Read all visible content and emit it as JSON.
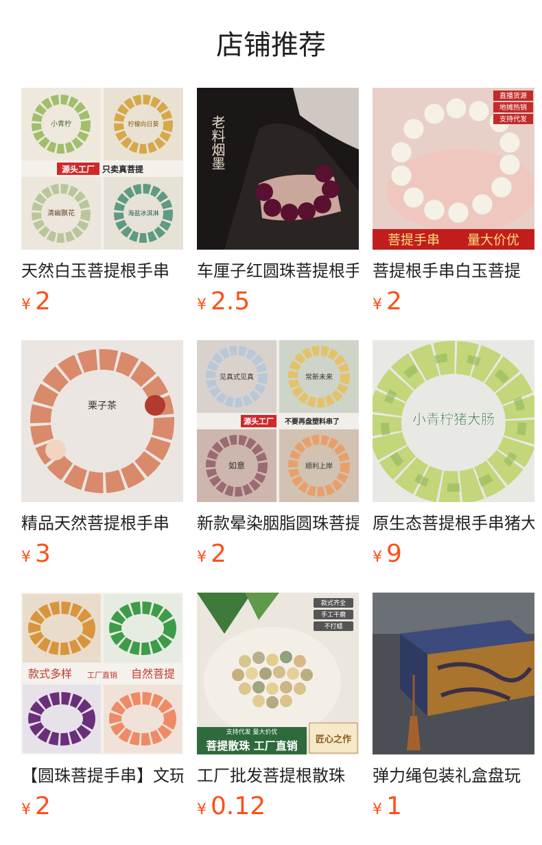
{
  "header": {
    "title": "店铺推荐"
  },
  "currency_symbol": "¥",
  "products": [
    {
      "name": "天然白玉菩提根手串",
      "price": "2",
      "image": {
        "desc_icon": "bracelet-collage-image",
        "quadrant_labels": [
          "小青柠",
          "柠檬向日葵",
          "清幽飘花",
          "海盐冰淇淋"
        ],
        "banner_tag": "源头工厂",
        "banner_text": "只卖真菩提"
      }
    },
    {
      "name": "车厘子红圆珠菩提根手串",
      "price": "2.5",
      "image": {
        "desc_icon": "bracelet-on-wrist-image",
        "title_text": "老料烟墨"
      }
    },
    {
      "name": "菩提根手串白玉菩提",
      "price": "2",
      "image": {
        "desc_icon": "white-bead-bracelet-image",
        "badges": [
          "直播货源",
          "地摊热销",
          "支持代发"
        ],
        "banner_left": "菩提手串",
        "banner_right": "量大价优"
      }
    },
    {
      "name": "精品天然菩提根手串",
      "price": "3",
      "image": {
        "desc_icon": "orange-bead-bracelet-image",
        "center_text": "栗子茶"
      }
    },
    {
      "name": "新款晕染胭脂圆珠菩提根手串",
      "price": "2",
      "image": {
        "desc_icon": "bracelet-collage-image",
        "quadrant_labels": [
          "见真式见真",
          "常新未来",
          "如意",
          "顺利上岸"
        ],
        "banner_tag": "源头工厂",
        "banner_text": "不要再盘塑料串了"
      }
    },
    {
      "name": "原生态菩提根手串猪大肠",
      "price": "9",
      "image": {
        "desc_icon": "green-bead-bracelet-image",
        "overlay_text": "小青柠猪大肠"
      }
    },
    {
      "name": "【圆珠菩提手串】文玩",
      "price": "2",
      "image": {
        "desc_icon": "bracelet-collage-image",
        "labels": [
          "款式多样",
          "工厂直销",
          "自然菩提"
        ]
      }
    },
    {
      "name": "工厂批发菩提根散珠",
      "price": "0.12",
      "image": {
        "desc_icon": "loose-beads-image",
        "badges": [
          "款式齐全",
          "手工干磨",
          "不打蜡"
        ],
        "banner_small": "支持代发 量大价优",
        "banner_text": "菩提散珠 工厂直销",
        "seal_text": "匠心之作"
      }
    },
    {
      "name": "弹力绳包装礼盒盘玩",
      "price": "1",
      "image": {
        "desc_icon": "gift-box-image"
      }
    }
  ],
  "colors": {
    "price": "#ff4e16",
    "title": "#1f1f1f",
    "text": "#222222"
  }
}
